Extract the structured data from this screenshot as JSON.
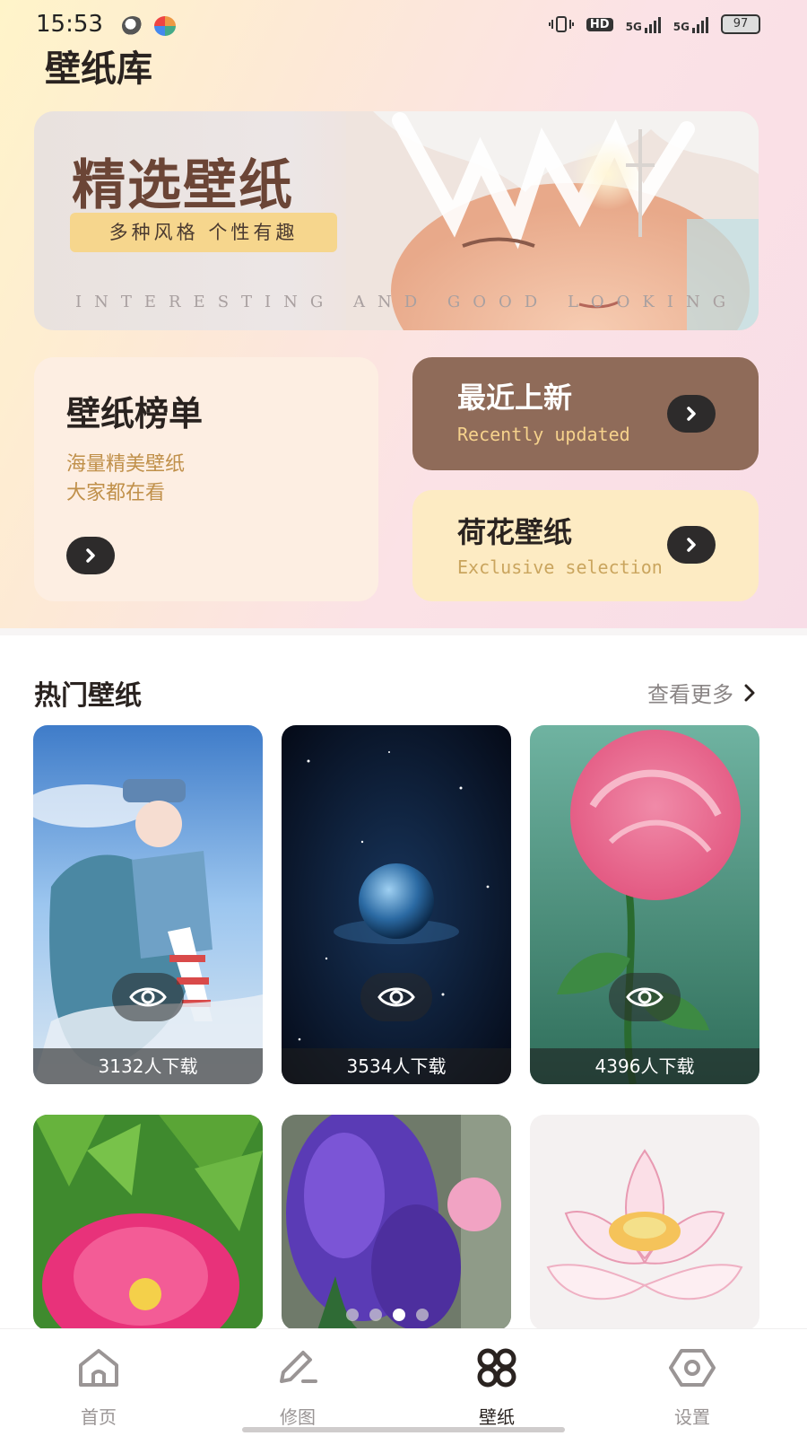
{
  "status_bar": {
    "time": "15:53",
    "network_1": "5G",
    "network_2": "5G",
    "hd_label": "HD",
    "battery": "97"
  },
  "page_title": "壁纸库",
  "banner": {
    "title": "精选壁纸",
    "subtitle": "多种风格 个性有趣",
    "tagline": "INTERESTING AND GOOD LOOKING"
  },
  "cards": {
    "rank": {
      "title": "壁纸榜单",
      "desc_line1": "海量精美壁纸",
      "desc_line2": "大家都在看"
    },
    "new": {
      "title": "最近上新",
      "subtitle": "Recently updated"
    },
    "lotus": {
      "title": "荷花壁纸",
      "subtitle": "Exclusive selection"
    }
  },
  "hot_section": {
    "title": "热门壁纸",
    "see_more": "查看更多",
    "items": [
      {
        "downloads": "3132人下载",
        "theme": "anime-girl"
      },
      {
        "downloads": "3534人下载",
        "theme": "planet-space"
      },
      {
        "downloads": "4396人下载",
        "theme": "pink-rose"
      },
      {
        "theme": "peony"
      },
      {
        "theme": "hyacinth"
      },
      {
        "theme": "lotus"
      }
    ]
  },
  "pager": {
    "count": 4,
    "active_index": 2
  },
  "tabbar": [
    {
      "label": "首页",
      "icon": "home-icon"
    },
    {
      "label": "修图",
      "icon": "edit-icon"
    },
    {
      "label": "壁纸",
      "icon": "grid-icon",
      "active": true
    },
    {
      "label": "设置",
      "icon": "settings-icon"
    }
  ],
  "colors": {
    "accent_brown": "#8f6b59",
    "card_peach": "#fdeee2",
    "card_cream": "#fdebc3",
    "gold_text": "#c0904a",
    "banner_label": "#f6d68d"
  }
}
